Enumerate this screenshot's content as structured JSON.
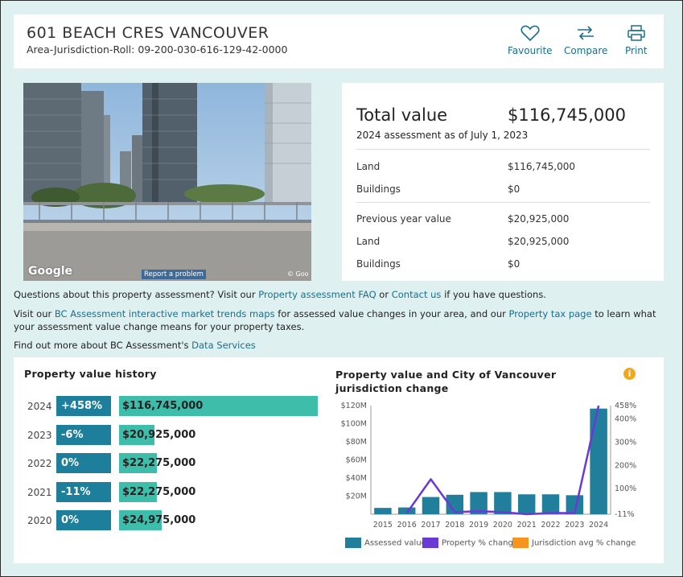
{
  "header": {
    "address": "601 BEACH CRES VANCOUVER",
    "roll": "Area-Jurisdiction-Roll: 09-200-030-616-129-42-0000",
    "favourite_label": "Favourite",
    "compare_label": "Compare",
    "print_label": "Print"
  },
  "photo": {
    "google_logo": "Google",
    "report_label": "Report a problem",
    "copyright": "© Goo"
  },
  "summary": {
    "total_label": "Total value",
    "total_value": "$116,745,000",
    "subtitle": "2024 assessment as of July 1, 2023",
    "land_label": "Land",
    "land_value": "$116,745,000",
    "buildings_label": "Buildings",
    "buildings_value": "$0",
    "prev_label": "Previous year value",
    "prev_value": "$20,925,000",
    "prev_land_label": "Land",
    "prev_land_value": "$20,925,000",
    "prev_buildings_label": "Buildings",
    "prev_buildings_value": "$0"
  },
  "info": {
    "p1_pre": "Questions about this property assessment? Visit our ",
    "p1_link1": "Property assessment FAQ",
    "p1_mid": " or ",
    "p1_link2": "Contact us",
    "p1_post": " if you have questions.",
    "p2_pre": "Visit our ",
    "p2_link1": "BC Assessment interactive market trends maps",
    "p2_mid": " for assessed value changes in your area, and our ",
    "p2_link2": "Property tax page",
    "p2_post": " to learn what your assessment value change means for your property taxes.",
    "p3_pre": "Find out more about BC Assessment's ",
    "p3_link": "Data Services"
  },
  "history": {
    "title": "Property value history",
    "rows": [
      {
        "year": "2024",
        "pct": "+458%",
        "value": "$116,745,000",
        "amount": 116745000
      },
      {
        "year": "2023",
        "pct": "-6%",
        "value": "$20,925,000",
        "amount": 20925000
      },
      {
        "year": "2022",
        "pct": "0%",
        "value": "$22,275,000",
        "amount": 22275000
      },
      {
        "year": "2021",
        "pct": "-11%",
        "value": "$22,275,000",
        "amount": 22275000
      },
      {
        "year": "2020",
        "pct": "0%",
        "value": "$24,975,000",
        "amount": 24975000
      }
    ]
  },
  "chart_title": "Property value and City of Vancouver jurisdiction change",
  "chart_data": {
    "type": "bar",
    "title": "Property value and City of Vancouver jurisdiction change",
    "categories": [
      "2015",
      "2016",
      "2017",
      "2018",
      "2019",
      "2020",
      "2021",
      "2022",
      "2023",
      "2024"
    ],
    "series": [
      {
        "name": "Assessed value",
        "type": "bar",
        "axis": "left",
        "color": "#217f9c",
        "values": [
          7,
          7.5,
          19,
          21.5,
          24.5,
          24.5,
          22,
          22,
          21,
          116.7
        ]
      },
      {
        "name": "Property % change",
        "type": "line",
        "axis": "right",
        "color": "#6a39d6",
        "values": [
          null,
          -6,
          140,
          -2,
          2,
          -2,
          -11,
          -6,
          -6,
          458
        ]
      },
      {
        "name": "Jurisdiction avg % change",
        "type": "line",
        "axis": "right",
        "color": "#f7941d",
        "values": []
      }
    ],
    "y_left": {
      "ticks": [
        "$120M",
        "$100M",
        "$80M",
        "$60M",
        "$40M",
        "$20M"
      ],
      "tick_values": [
        120,
        100,
        80,
        60,
        40,
        20
      ],
      "range": [
        0,
        120
      ]
    },
    "y_right": {
      "ticks": [
        "458%",
        "400%",
        "300%",
        "200%",
        "100%",
        "-11%"
      ],
      "tick_values": [
        458,
        400,
        300,
        200,
        100,
        -11
      ],
      "range": [
        -11,
        458
      ]
    },
    "grid": false,
    "legend": "bottom"
  },
  "colors": {
    "page_bg": "#dff0f1",
    "dark_teal": "#1e7f9c",
    "light_teal": "#3dbdaa",
    "link": "#1a6e8c",
    "purple": "#6a39d6",
    "orange": "#f7941d"
  },
  "icons": [
    "heart-icon",
    "compare-arrows-icon",
    "printer-icon",
    "info-icon"
  ]
}
